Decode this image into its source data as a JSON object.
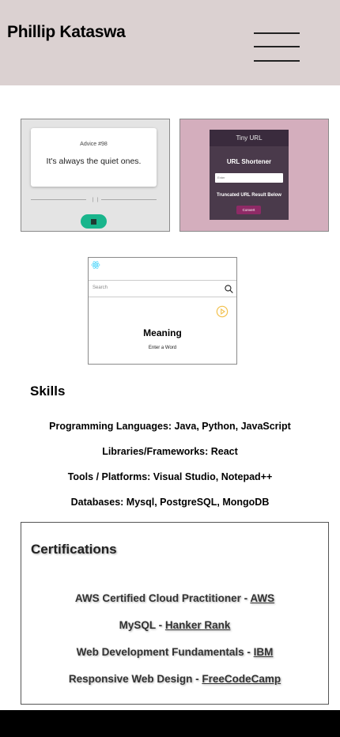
{
  "header": {
    "name": "Phillip Kataswa",
    "background": "#dbd1d1"
  },
  "projects": {
    "advice": {
      "number": "Advice #98",
      "quote": "It's always the quiet ones.",
      "pause_glyph": "❙❙"
    },
    "tiny_url": {
      "title": "Tiny URL",
      "subtitle": "URL Shortener",
      "input_placeholder": "Enter",
      "result_label": "Truncated URL Result Below",
      "button": "Convert"
    },
    "dictionary": {
      "search_placeholder": "Search",
      "word": "Meaning",
      "hint": "Enter a Word"
    }
  },
  "skills": {
    "title": "Skills",
    "lines": [
      "Programming Languages: Java, Python, JavaScript",
      "Libraries/Frameworks: React",
      "Tools / Platforms: Visual Studio, Notepad++",
      "Databases: Mysql, PostgreSQL, MongoDB"
    ]
  },
  "certifications": {
    "title": "Certifications",
    "items": [
      {
        "name": "AWS Certified Cloud Practitioner - ",
        "issuer": "AWS"
      },
      {
        "name": "MySQL - ",
        "issuer": "Hanker Rank"
      },
      {
        "name": "Web Development Fundamentals - ",
        "issuer": "IBM"
      },
      {
        "name": "Responsive Web Design - ",
        "issuer": "FreeCodeCamp"
      }
    ]
  },
  "colors": {
    "advice_button": "#19b58c",
    "tiny_background": "#d4aebd",
    "tiny_panel": "#4a3a4b",
    "tiny_button": "#8e2a66",
    "footer": "#000000"
  }
}
